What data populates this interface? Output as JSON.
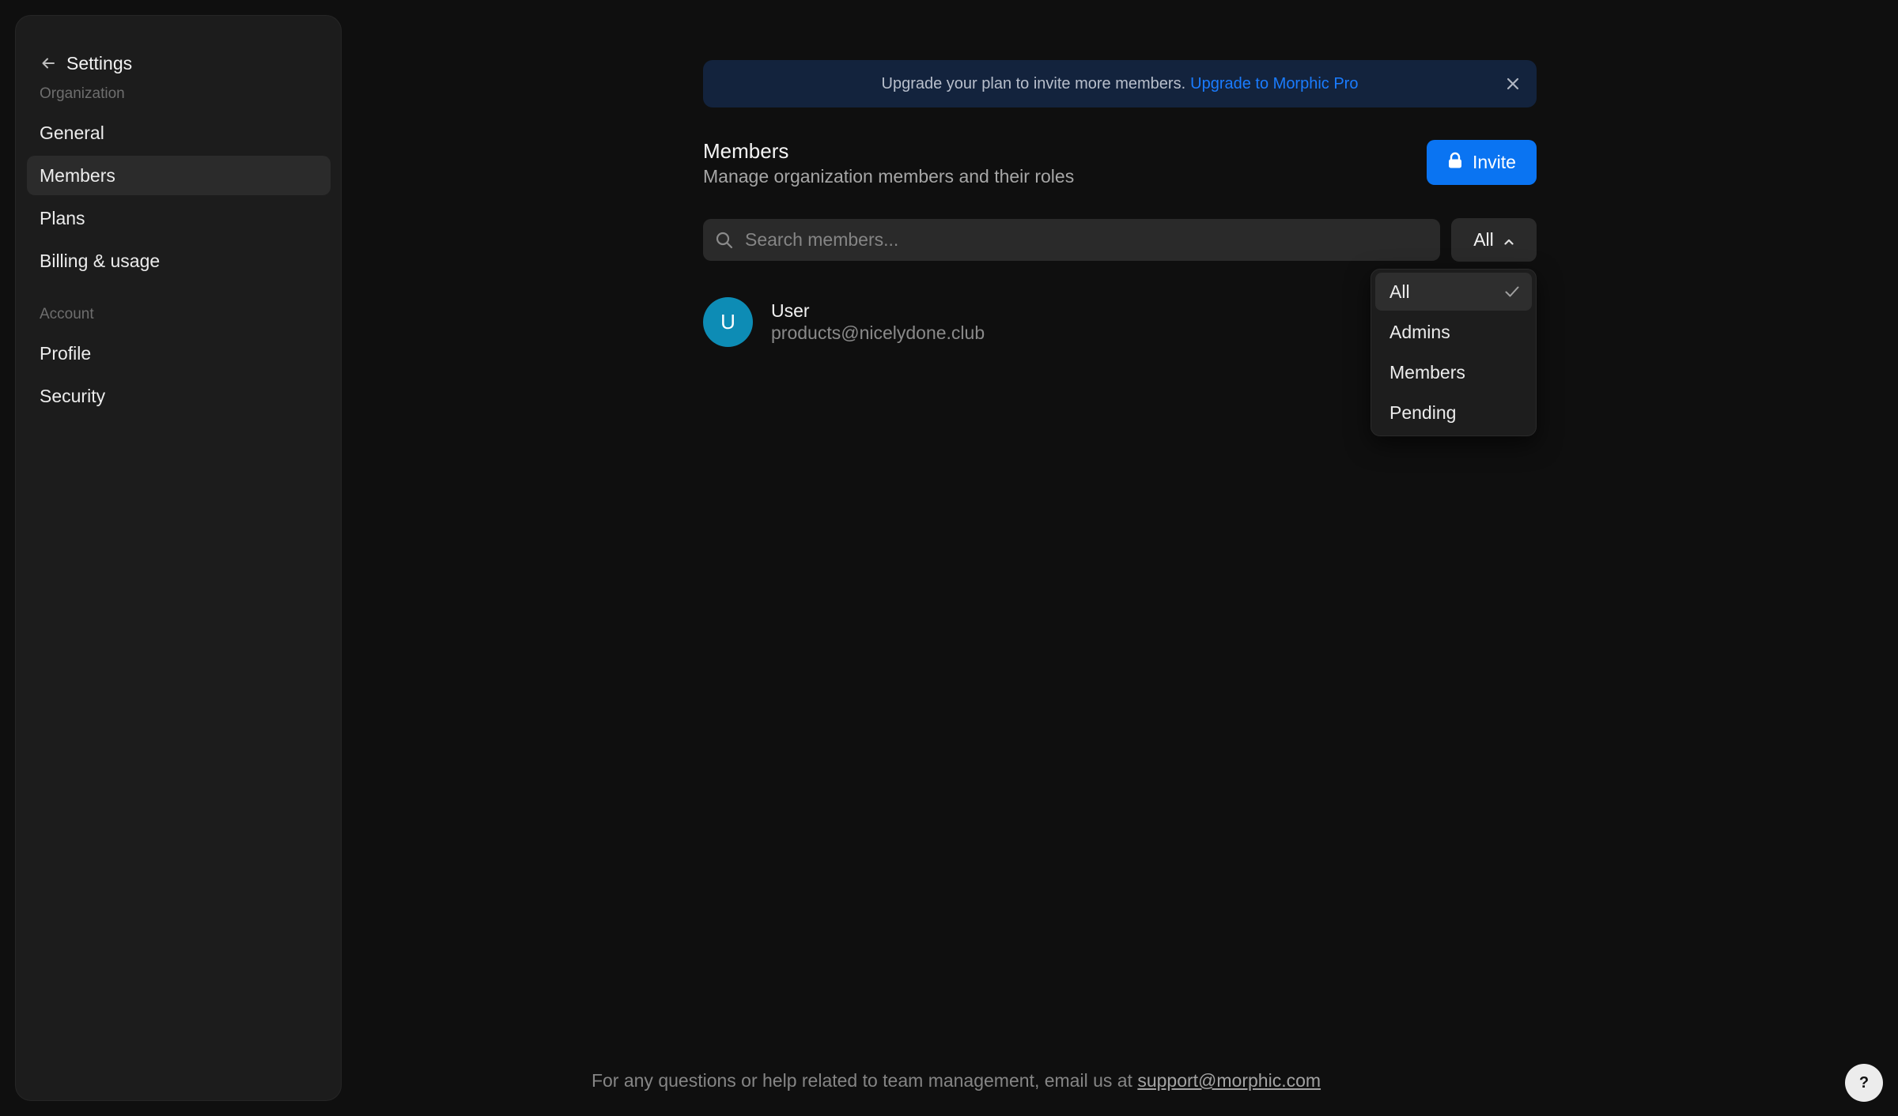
{
  "sidebar": {
    "back_icon": "arrow-left-icon",
    "title": "Settings",
    "sections": [
      {
        "label": "Organization",
        "items": [
          "General",
          "Members",
          "Plans",
          "Billing & usage"
        ]
      },
      {
        "label": "Account",
        "items": [
          "Profile",
          "Security"
        ]
      }
    ],
    "active_item": "Members"
  },
  "banner": {
    "text": "Upgrade your plan to invite more members.",
    "link_text": "Upgrade to Morphic Pro",
    "link_color": "#1a7cff",
    "close_icon": "close-icon"
  },
  "header": {
    "title": "Members",
    "subtitle": "Manage organization members and their roles",
    "invite_label": "Invite",
    "invite_icon": "lock-icon",
    "accent_color": "#0a74f2"
  },
  "search": {
    "placeholder": "Search members...",
    "value": "",
    "icon": "search-icon"
  },
  "filter": {
    "selected": "All",
    "icon": "chevron-up-icon",
    "options": [
      "All",
      "Admins",
      "Members",
      "Pending"
    ]
  },
  "members": [
    {
      "initial": "U",
      "name": "User",
      "email": "products@nicelydone.club",
      "avatar_color": "#0d8cb5"
    }
  ],
  "footer": {
    "text": "For any questions or help related to team management, email us at",
    "email": "support@morphic.com"
  },
  "help_button": {
    "label": "?"
  }
}
